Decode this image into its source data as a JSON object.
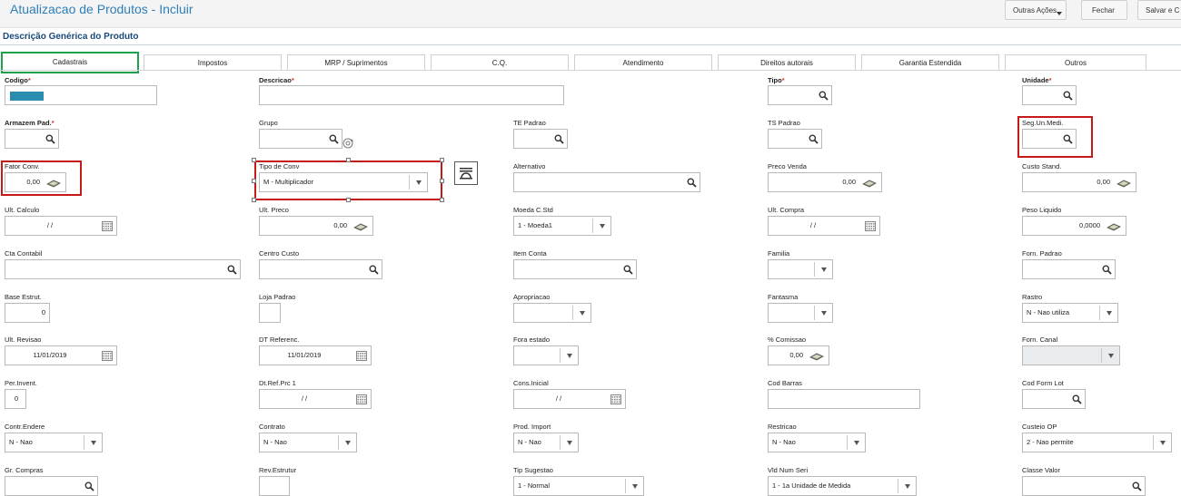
{
  "app": {
    "title": "Atualizacao de Produtos - Incluir",
    "buttons": {
      "outras_acoes": "Outras Ações",
      "fechar": "Fechar",
      "salvar": "Salvar e C"
    }
  },
  "section_title": "Descrição Genérica do Produto",
  "tabs": [
    "Cadastrais",
    "Impostos",
    "MRP / Suprimentos",
    "C.Q.",
    "Atendimento",
    "Direitos autorais",
    "Garantia Estendida",
    "Outros"
  ],
  "fields": {
    "codigo": {
      "label": "Codigo",
      "value": ""
    },
    "descricao": {
      "label": "Descricao",
      "value": ""
    },
    "tipo": {
      "label": "Tipo",
      "value": ""
    },
    "unidade": {
      "label": "Unidade",
      "value": ""
    },
    "armazem": {
      "label": "Armazem Pad.",
      "value": ""
    },
    "grupo": {
      "label": "Grupo",
      "value": ""
    },
    "te_padrao": {
      "label": "TE Padrao",
      "value": ""
    },
    "ts_padrao": {
      "label": "TS Padrao",
      "value": ""
    },
    "seg_un": {
      "label": "Seg.Un.Medi.",
      "value": ""
    },
    "fator_conv": {
      "label": "Fator Conv.",
      "value": "0,00"
    },
    "tipo_conv": {
      "label": "Tipo de Conv",
      "value": "M - Multiplicador"
    },
    "alternativo": {
      "label": "Alternativo",
      "value": ""
    },
    "preco_venda": {
      "label": "Preco Venda",
      "value": "0,00"
    },
    "custo_stand": {
      "label": "Custo Stand.",
      "value": "0,00"
    },
    "ult_calculo": {
      "label": "Ult. Calculo",
      "value": "/ /"
    },
    "ult_preco": {
      "label": "Ult. Preco",
      "value": "0,00"
    },
    "moeda": {
      "label": "Moeda C.Std",
      "value": "1 - Moeda1"
    },
    "ult_compra": {
      "label": "Ult. Compra",
      "value": "/ /"
    },
    "peso_liquido": {
      "label": "Peso Liquido",
      "value": "0,0000"
    },
    "cta_contabil": {
      "label": "Cta Contabil",
      "value": ""
    },
    "centro_custo": {
      "label": "Centro Custo",
      "value": ""
    },
    "item_conta": {
      "label": "Item Conta",
      "value": ""
    },
    "familia": {
      "label": "Familia",
      "value": ""
    },
    "forn_padrao": {
      "label": "Forn. Padrao",
      "value": ""
    },
    "base_estrut": {
      "label": "Base Estrut.",
      "value": "0"
    },
    "loja_padrao": {
      "label": "Loja Padrao",
      "value": ""
    },
    "apropriacao": {
      "label": "Apropriacao",
      "value": ""
    },
    "fantasma": {
      "label": "Fantasma",
      "value": ""
    },
    "rastro": {
      "label": "Rastro",
      "value": "N - Nao utiliza"
    },
    "ult_revisao": {
      "label": "Ult. Revisao",
      "value": "11/01/2019"
    },
    "dt_referenc": {
      "label": "DT Referenc.",
      "value": "11/01/2019"
    },
    "fora_estado": {
      "label": "Fora estado",
      "value": ""
    },
    "comissao": {
      "label": "% Comissao",
      "value": "0,00"
    },
    "forn_canal": {
      "label": "Forn. Canal",
      "value": ""
    },
    "per_invent": {
      "label": "Per.Invent.",
      "value": "0"
    },
    "dt_ref_prc": {
      "label": "Dt.Ref.Prc 1",
      "value": "/ /"
    },
    "cons_inicial": {
      "label": "Cons.Inicial",
      "value": "/ /"
    },
    "cod_barras": {
      "label": "Cod Barras",
      "value": ""
    },
    "cod_form_lot": {
      "label": "Cod Form Lot",
      "value": ""
    },
    "contr_endere": {
      "label": "Contr.Endere",
      "value": "N - Nao"
    },
    "contrato": {
      "label": "Contrato",
      "value": "N - Nao"
    },
    "prod_import": {
      "label": "Prod. Import",
      "value": "N - Nao"
    },
    "restricao": {
      "label": "Restricao",
      "value": "N - Nao"
    },
    "custeio_op": {
      "label": "Custeio OP",
      "value": "2 - Nao permite"
    },
    "gr_compras": {
      "label": "Gr. Compras",
      "value": ""
    },
    "rev_estrutur": {
      "label": "Rev.Estrutur",
      "value": ""
    },
    "tip_sugestao": {
      "label": "Tip Sugestao",
      "value": "1 - Normal"
    },
    "vld_num_seri": {
      "label": "Vld Num Seri",
      "value": "1 - 1a Unidade de Medida"
    },
    "classe_valor": {
      "label": "Classe Valor",
      "value": ""
    }
  },
  "required_marker": "*",
  "colors": {
    "title": "#2d7fb8",
    "section": "#1a4a7a",
    "highlight_red": "#c61a1a",
    "active_tab": "#1ea14c",
    "code_fill": "#2a8cae"
  }
}
